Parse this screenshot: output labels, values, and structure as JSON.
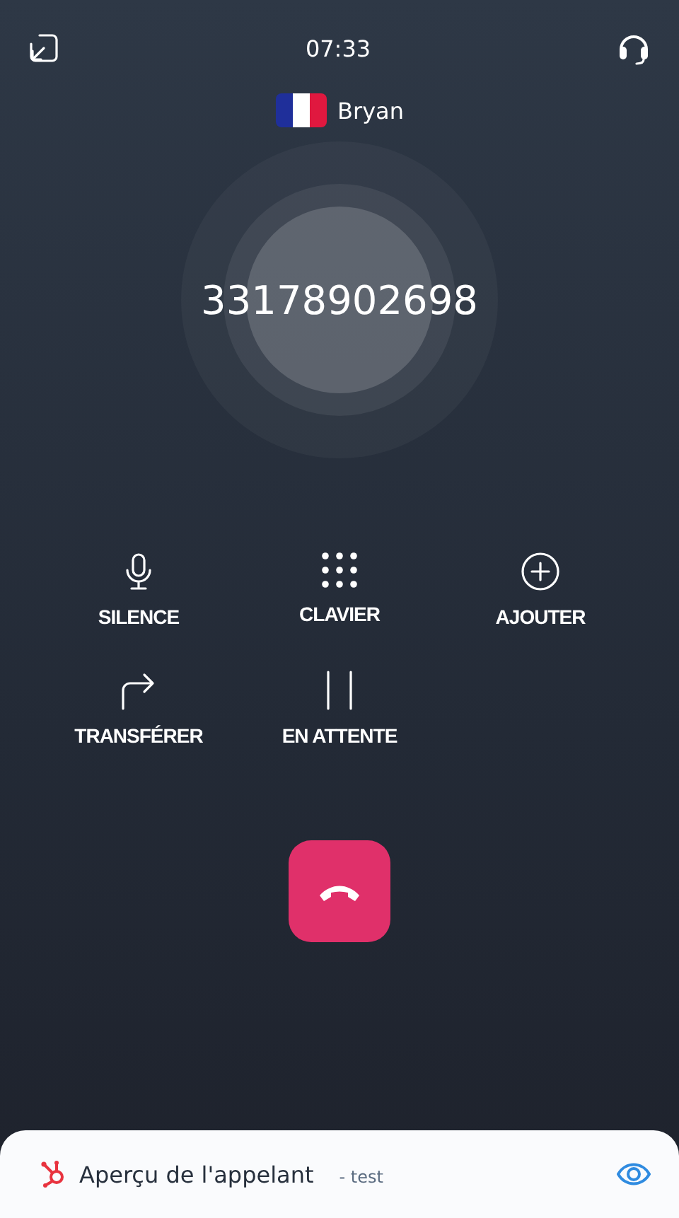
{
  "header": {
    "time": "07:33"
  },
  "caller": {
    "name": "Bryan",
    "number": "33178902698"
  },
  "actions": [
    {
      "kind": "mic",
      "label": "SILENCE"
    },
    {
      "kind": "keypad",
      "label": "CLAVIER"
    },
    {
      "kind": "add",
      "label": "AJOUTER"
    },
    {
      "kind": "transfer",
      "label": "TRANSFÉRER"
    },
    {
      "kind": "hold",
      "label": "EN ATTENTE"
    }
  ],
  "preview": {
    "title": "Aperçu de l'appelant",
    "subtitle": "- test"
  }
}
